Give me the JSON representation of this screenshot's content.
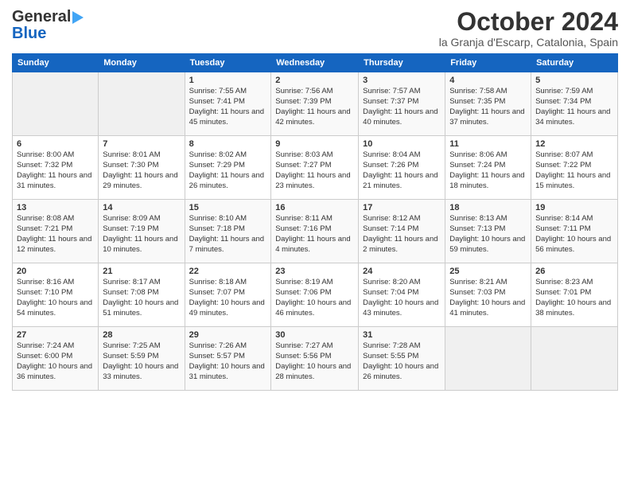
{
  "logo": {
    "line1": "General",
    "line2": "Blue"
  },
  "title": "October 2024",
  "subtitle": "la Granja d'Escarp, Catalonia, Spain",
  "days_of_week": [
    "Sunday",
    "Monday",
    "Tuesday",
    "Wednesday",
    "Thursday",
    "Friday",
    "Saturday"
  ],
  "weeks": [
    [
      {
        "day": "",
        "empty": true
      },
      {
        "day": "",
        "empty": true
      },
      {
        "day": "1",
        "sunrise": "7:55 AM",
        "sunset": "7:41 PM",
        "daylight": "11 hours and 45 minutes."
      },
      {
        "day": "2",
        "sunrise": "7:56 AM",
        "sunset": "7:39 PM",
        "daylight": "11 hours and 42 minutes."
      },
      {
        "day": "3",
        "sunrise": "7:57 AM",
        "sunset": "7:37 PM",
        "daylight": "11 hours and 40 minutes."
      },
      {
        "day": "4",
        "sunrise": "7:58 AM",
        "sunset": "7:35 PM",
        "daylight": "11 hours and 37 minutes."
      },
      {
        "day": "5",
        "sunrise": "7:59 AM",
        "sunset": "7:34 PM",
        "daylight": "11 hours and 34 minutes."
      }
    ],
    [
      {
        "day": "6",
        "sunrise": "8:00 AM",
        "sunset": "7:32 PM",
        "daylight": "11 hours and 31 minutes."
      },
      {
        "day": "7",
        "sunrise": "8:01 AM",
        "sunset": "7:30 PM",
        "daylight": "11 hours and 29 minutes."
      },
      {
        "day": "8",
        "sunrise": "8:02 AM",
        "sunset": "7:29 PM",
        "daylight": "11 hours and 26 minutes."
      },
      {
        "day": "9",
        "sunrise": "8:03 AM",
        "sunset": "7:27 PM",
        "daylight": "11 hours and 23 minutes."
      },
      {
        "day": "10",
        "sunrise": "8:04 AM",
        "sunset": "7:26 PM",
        "daylight": "11 hours and 21 minutes."
      },
      {
        "day": "11",
        "sunrise": "8:06 AM",
        "sunset": "7:24 PM",
        "daylight": "11 hours and 18 minutes."
      },
      {
        "day": "12",
        "sunrise": "8:07 AM",
        "sunset": "7:22 PM",
        "daylight": "11 hours and 15 minutes."
      }
    ],
    [
      {
        "day": "13",
        "sunrise": "8:08 AM",
        "sunset": "7:21 PM",
        "daylight": "11 hours and 12 minutes."
      },
      {
        "day": "14",
        "sunrise": "8:09 AM",
        "sunset": "7:19 PM",
        "daylight": "11 hours and 10 minutes."
      },
      {
        "day": "15",
        "sunrise": "8:10 AM",
        "sunset": "7:18 PM",
        "daylight": "11 hours and 7 minutes."
      },
      {
        "day": "16",
        "sunrise": "8:11 AM",
        "sunset": "7:16 PM",
        "daylight": "11 hours and 4 minutes."
      },
      {
        "day": "17",
        "sunrise": "8:12 AM",
        "sunset": "7:14 PM",
        "daylight": "11 hours and 2 minutes."
      },
      {
        "day": "18",
        "sunrise": "8:13 AM",
        "sunset": "7:13 PM",
        "daylight": "10 hours and 59 minutes."
      },
      {
        "day": "19",
        "sunrise": "8:14 AM",
        "sunset": "7:11 PM",
        "daylight": "10 hours and 56 minutes."
      }
    ],
    [
      {
        "day": "20",
        "sunrise": "8:16 AM",
        "sunset": "7:10 PM",
        "daylight": "10 hours and 54 minutes."
      },
      {
        "day": "21",
        "sunrise": "8:17 AM",
        "sunset": "7:08 PM",
        "daylight": "10 hours and 51 minutes."
      },
      {
        "day": "22",
        "sunrise": "8:18 AM",
        "sunset": "7:07 PM",
        "daylight": "10 hours and 49 minutes."
      },
      {
        "day": "23",
        "sunrise": "8:19 AM",
        "sunset": "7:06 PM",
        "daylight": "10 hours and 46 minutes."
      },
      {
        "day": "24",
        "sunrise": "8:20 AM",
        "sunset": "7:04 PM",
        "daylight": "10 hours and 43 minutes."
      },
      {
        "day": "25",
        "sunrise": "8:21 AM",
        "sunset": "7:03 PM",
        "daylight": "10 hours and 41 minutes."
      },
      {
        "day": "26",
        "sunrise": "8:23 AM",
        "sunset": "7:01 PM",
        "daylight": "10 hours and 38 minutes."
      }
    ],
    [
      {
        "day": "27",
        "sunrise": "7:24 AM",
        "sunset": "6:00 PM",
        "daylight": "10 hours and 36 minutes."
      },
      {
        "day": "28",
        "sunrise": "7:25 AM",
        "sunset": "5:59 PM",
        "daylight": "10 hours and 33 minutes."
      },
      {
        "day": "29",
        "sunrise": "7:26 AM",
        "sunset": "5:57 PM",
        "daylight": "10 hours and 31 minutes."
      },
      {
        "day": "30",
        "sunrise": "7:27 AM",
        "sunset": "5:56 PM",
        "daylight": "10 hours and 28 minutes."
      },
      {
        "day": "31",
        "sunrise": "7:28 AM",
        "sunset": "5:55 PM",
        "daylight": "10 hours and 26 minutes."
      },
      {
        "day": "",
        "empty": true
      },
      {
        "day": "",
        "empty": true
      }
    ]
  ]
}
